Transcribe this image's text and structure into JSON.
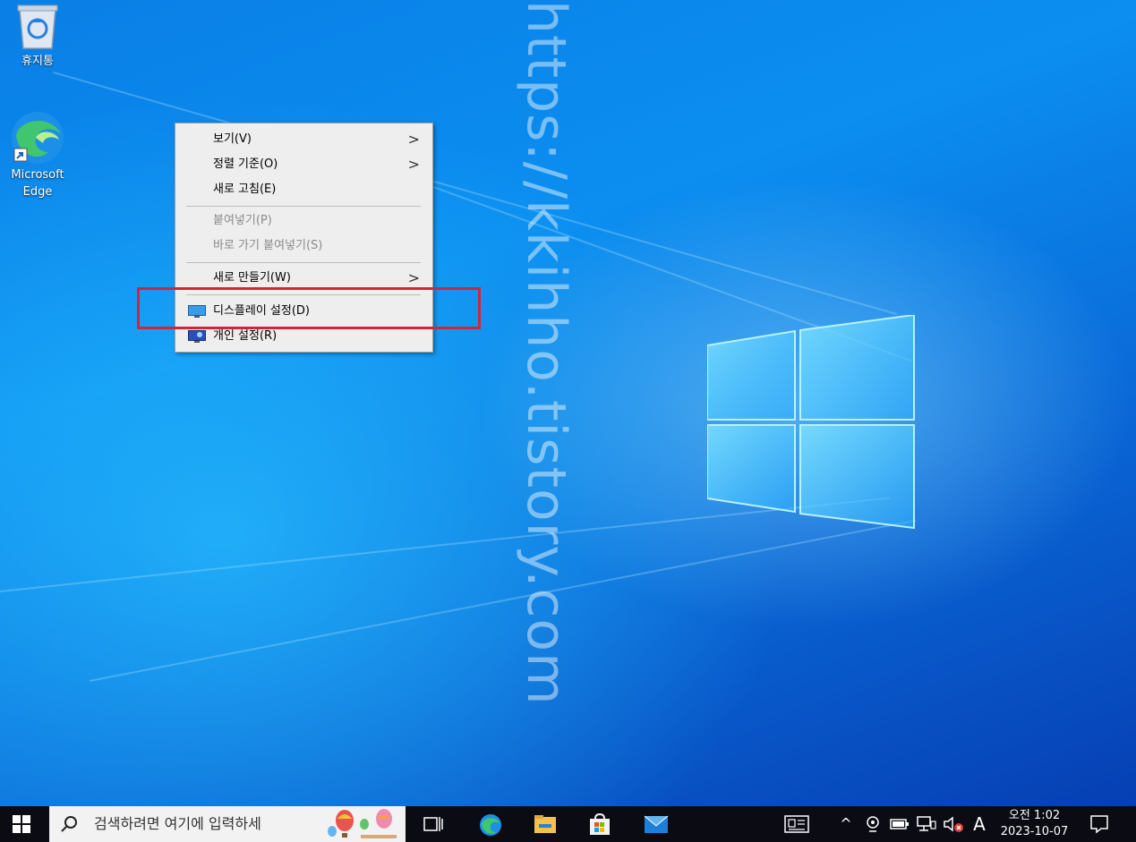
{
  "desktop": {
    "icons": [
      {
        "label": "휴지통"
      },
      {
        "label": "Microsoft Edge"
      }
    ],
    "watermark": "https://kkihho.tistory.com"
  },
  "context_menu": {
    "items": [
      {
        "label": "보기(V)",
        "submenu": true,
        "disabled": false
      },
      {
        "label": "정렬 기준(O)",
        "submenu": true,
        "disabled": false
      },
      {
        "label": "새로 고침(E)",
        "submenu": false,
        "disabled": false
      },
      {
        "label": "붙여넣기(P)",
        "submenu": false,
        "disabled": true
      },
      {
        "label": "바로 가기 붙여넣기(S)",
        "submenu": false,
        "disabled": true
      },
      {
        "label": "새로 만들기(W)",
        "submenu": true,
        "disabled": false
      },
      {
        "label": "디스플레이 설정(D)",
        "submenu": false,
        "disabled": false,
        "icon": "display-icon"
      },
      {
        "label": "개인 설정(R)",
        "submenu": false,
        "disabled": false,
        "icon": "personalize-icon"
      }
    ],
    "arrow_glyph": ">"
  },
  "taskbar": {
    "search_placeholder": "검색하려면 여기에 입력하세",
    "pinned": [
      "task-view-icon",
      "edge-icon",
      "file-explorer-icon",
      "store-icon",
      "mail-icon"
    ],
    "tray": {
      "chevron": "^",
      "input_indicator": "A",
      "time": "오전 1:02",
      "date": "2023-10-07"
    }
  },
  "colors": {
    "highlight": "#d0263a",
    "taskbar": "#0b0b14"
  }
}
